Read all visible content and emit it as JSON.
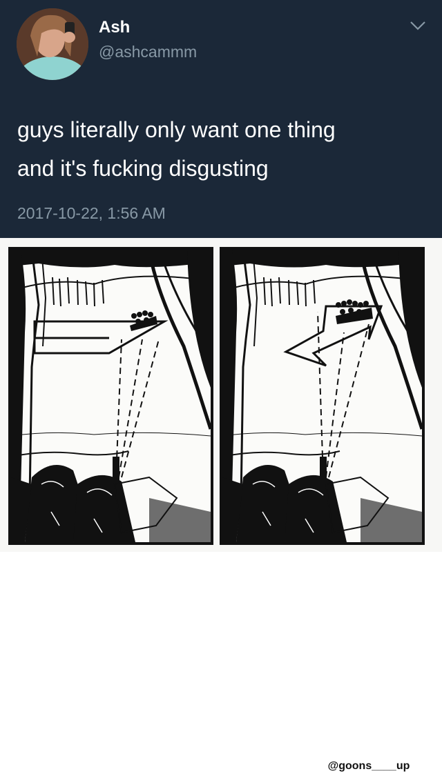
{
  "tweet": {
    "display_name": "Ash",
    "handle": "@ashcammm",
    "text_lines": [
      "guys literally only want one thing",
      "and it's fucking disgusting"
    ],
    "timestamp": "2017-10-22, 1:56 AM",
    "menu_icon": "chevron-down-icon"
  },
  "comic": {
    "watermark": "@goons____up"
  },
  "colors": {
    "tweet_background": "#1b2838",
    "display_name": "#ffffff",
    "secondary_text": "#8899a6",
    "comic_ink": "#111111"
  }
}
